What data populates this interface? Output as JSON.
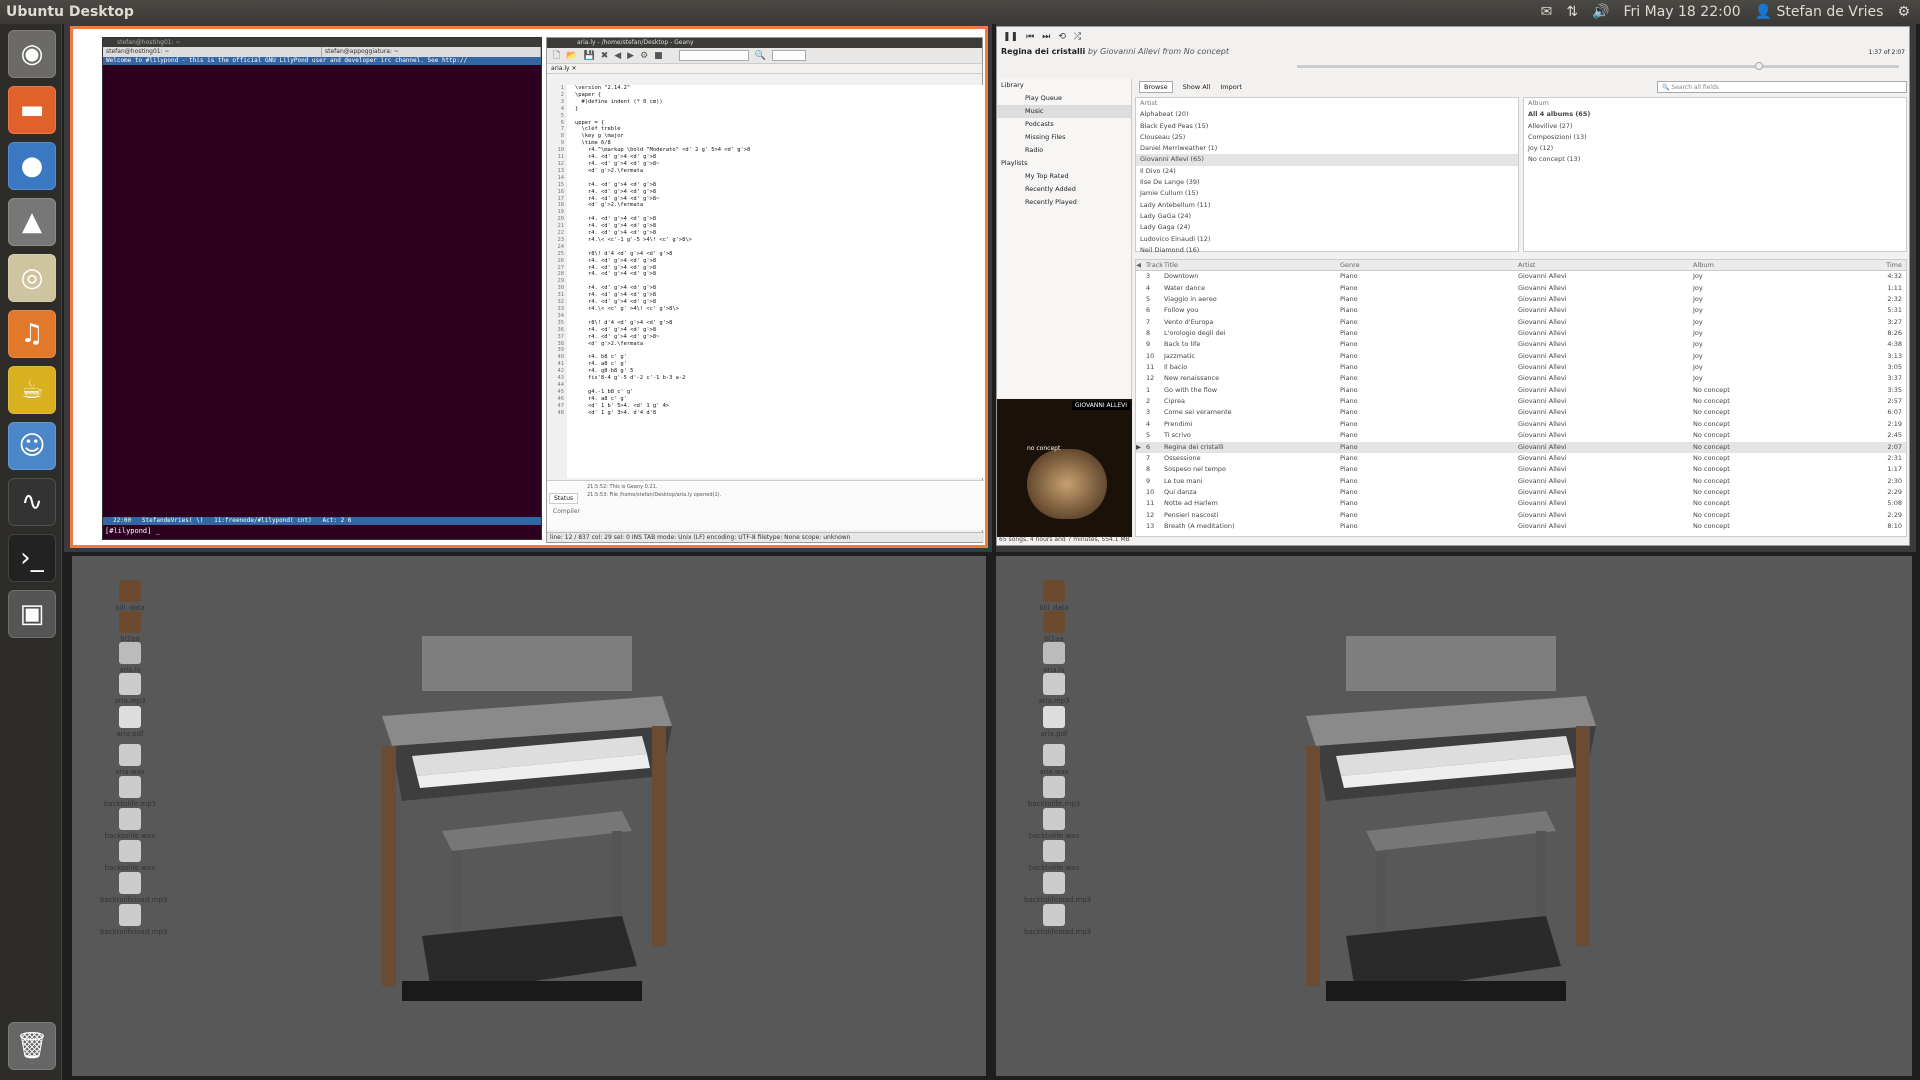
{
  "topbar": {
    "title": "Ubuntu Desktop",
    "datetime": "Fri May 18 22:00",
    "user": "Stefan de Vries"
  },
  "launcher": {
    "items": [
      "dash-icon",
      "files-icon",
      "firefox-icon",
      "inkscape-icon",
      "music-icon",
      "audacity-icon",
      "teapot-icon",
      "chat-icon",
      "system-monitor-icon",
      "terminal-icon",
      "workspace-icon",
      "trash-icon"
    ]
  },
  "desktop": {
    "icons": [
      "bill_data",
      "bl2aa",
      "aria.ly",
      "aria.mp3",
      "aria.pdf",
      "aria.wav",
      "backtolife.mp3",
      "backtolife.wav",
      "backtolife.wav",
      "backtolifeload.mp3",
      "backtolifeload.mp3"
    ]
  },
  "terminal": {
    "titlebar": "stefan@hosting01: ~",
    "tabs": [
      "stefan@hosting01: ~",
      "stefan@appoggiatura: ~"
    ],
    "topic": "Welcome to #lilypond - this is the official GNU LilyPond user and developer irc channel.  See http://",
    "statusbar": "22:00   StefandeVries( \\)   11:freenode/#lilypond( cnt)   Act: 2 6",
    "prompt": "[#lilypond] _"
  },
  "geany": {
    "titlebar": "aria.ly - /home/stefan/Desktop - Geany",
    "tab": "aria.ly",
    "code": "\\version \"2.14.2\"\n\\paper {\n  #(define indent (* 0 cm))\n}\n\nupper = {\n  \\clef treble\n  \\key g \\major\n  \\time 6/8\n    r4.^\\markup \\bold \"Moderato\" <d' 2 g' 5>4 <d' g'>8\n    r4. <d' g'>4 <d' g'>8\n    r4. <d' g'>4 <d' g'>8~\n    <d' g'>2.\\fermata\n\n    r4. <d' g'>4 <d' g'>8\n    r4. <d' g'>4 <d' g'>8\n    r4. <d' g'>4 <d' g'>8~\n    <d' g'>2.\\fermata\n\n    r4. <d' g'>4 <d' g'>8\n    r4. <d' g'>4 <d' g'>8\n    r4. <d' g'>4 <d' g'>8\n    r4.\\< <c'-1 g'-5 >4\\! <c' g'>8\\>\n\n    r8\\! d'4 <d' g'>4 <d' g'>8\n    r4. <d' g'>4 <d' g'>8\n    r4. <d' g'>4 <d' g'>8\n    r4. <d' g'>4 <d' g'>8\n\n    r4. <d' g'>4 <d' g'>8\n    r4. <d' g'>4 <d' g'>8\n    r4. <d' g'>4 <d' g'>8\n    r4.\\< <c' g' >4\\! <c' g'>8\\>\n\n    r8\\! d'4 <d' g'>4 <d' g'>8\n    r4. <d' g'>4 <d' g'>8\n    r4. <d' g'>4 <d' g'>8~\n    <d' g'>2.\\fermata\n\n    r4. b8 c' g'\n    r4. a8 c' g'\n    r4. g8 b8 g' 5\n    fis'8-4 g'-5 d'-2 c'-1 b-3 a-2\n\n    g4.-1 b8 c' g'\n    r4. a8 c' g'\n    <d' 1 b' 5>4. <d' 1 g' 4>\n    <d' 1 g' 3>4. d'4 d'8",
    "msg_line1": "21:5:52: This is Geany 0.21.",
    "msg_line2": "21:5:53: File /home/stefan/Desktop/aria.ly opened(1).",
    "bottom_tabs": [
      "Status",
      "Compiler"
    ],
    "statusbar": "line: 12 / 837    col: 29    sel: 0    INS    TAB    mode: Unix (LF)    encoding: UTF-8    filetype: None    scope: unknown"
  },
  "rhythmbox": {
    "now_playing_title": "Regina dei cristalli",
    "now_playing_by": "by Giovanni Allevi from No concept",
    "time": "1:37 of 2:07",
    "library_header": "Library",
    "library": [
      "Play Queue",
      "Music",
      "Podcasts",
      "Missing Files",
      "Radio"
    ],
    "playlists_header": "Playlists",
    "playlists": [
      "My Top Rated",
      "Recently Added",
      "Recently Played"
    ],
    "browse_tabs": [
      "Browse",
      "Show All",
      "Import"
    ],
    "search_placeholder": "Search all fields",
    "artist_header": "Artist",
    "artists": [
      "Alphabeat (20)",
      "Black Eyed Peas (15)",
      "Clouseau (25)",
      "Daniel Merriweather (1)",
      "Giovanni Allevi (65)",
      "Il Divo (24)",
      "Ilse De Lange (39)",
      "Jamie Cullum (15)",
      "Lady Antebellum (11)",
      "Lady GaGa (24)",
      "Lady Gaga (24)",
      "Ludovico Einaudi (12)",
      "Neil Diamond (16)"
    ],
    "album_header": "Album",
    "albums": [
      "All 4 albums (65)",
      "Allevilive (27)",
      "Composizioni (13)",
      "Joy (12)",
      "No concept (13)"
    ],
    "columns": [
      "Track",
      "Title",
      "Genre",
      "Artist",
      "Album",
      "Time"
    ],
    "tracks": [
      [
        "3",
        "Downtown",
        "Piano",
        "Giovanni Allevi",
        "Joy",
        "4:32"
      ],
      [
        "4",
        "Water dance",
        "Piano",
        "Giovanni Allevi",
        "Joy",
        "1:11"
      ],
      [
        "5",
        "Viaggio in aereo",
        "Piano",
        "Giovanni Allevi",
        "Joy",
        "2:32"
      ],
      [
        "6",
        "Follow you",
        "Piano",
        "Giovanni Allevi",
        "Joy",
        "5:31"
      ],
      [
        "7",
        "Vento d'Europa",
        "Piano",
        "Giovanni Allevi",
        "Joy",
        "3:27"
      ],
      [
        "8",
        "L'orologio degli dei",
        "Piano",
        "Giovanni Allevi",
        "Joy",
        "8:26"
      ],
      [
        "9",
        "Back to life",
        "Piano",
        "Giovanni Allevi",
        "Joy",
        "4:38"
      ],
      [
        "10",
        "Jazzmatic",
        "Piano",
        "Giovanni Allevi",
        "Joy",
        "3:13"
      ],
      [
        "11",
        "Il bacio",
        "Piano",
        "Giovanni Allevi",
        "Joy",
        "3:05"
      ],
      [
        "12",
        "New renaissance",
        "Piano",
        "Giovanni Allevi",
        "Joy",
        "3:37"
      ],
      [
        "1",
        "Go with the flow",
        "Piano",
        "Giovanni Allevi",
        "No concept",
        "3:35"
      ],
      [
        "2",
        "Ciprea",
        "Piano",
        "Giovanni Allevi",
        "No concept",
        "2:57"
      ],
      [
        "3",
        "Come sei veramente",
        "Piano",
        "Giovanni Allevi",
        "No concept",
        "6:07"
      ],
      [
        "4",
        "Prendimi",
        "Piano",
        "Giovanni Allevi",
        "No concept",
        "2:19"
      ],
      [
        "5",
        "Ti scrivo",
        "Piano",
        "Giovanni Allevi",
        "No concept",
        "2:45"
      ],
      [
        "6",
        "Regina dei cristalli",
        "Piano",
        "Giovanni Allevi",
        "No concept",
        "2:07"
      ],
      [
        "7",
        "Ossessione",
        "Piano",
        "Giovanni Allevi",
        "No concept",
        "2:31"
      ],
      [
        "8",
        "Sospeso nel tempo",
        "Piano",
        "Giovanni Allevi",
        "No concept",
        "1:17"
      ],
      [
        "9",
        "Le tue mani",
        "Piano",
        "Giovanni Allevi",
        "No concept",
        "2:30"
      ],
      [
        "10",
        "Qui danza",
        "Piano",
        "Giovanni Allevi",
        "No concept",
        "2:29"
      ],
      [
        "11",
        "Notte ad Harlem",
        "Piano",
        "Giovanni Allevi",
        "No concept",
        "5:08"
      ],
      [
        "12",
        "Pensieri nascosti",
        "Piano",
        "Giovanni Allevi",
        "No concept",
        "2:29"
      ],
      [
        "13",
        "Breath (A meditation)",
        "Piano",
        "Giovanni Allevi",
        "No concept",
        "8:10"
      ]
    ],
    "album_art_label": "GIOVANNI ALLEVI",
    "album_art_sub": "no concept",
    "footer": "65 songs, 4 hours and 7 minutes, 554.1 MB"
  }
}
